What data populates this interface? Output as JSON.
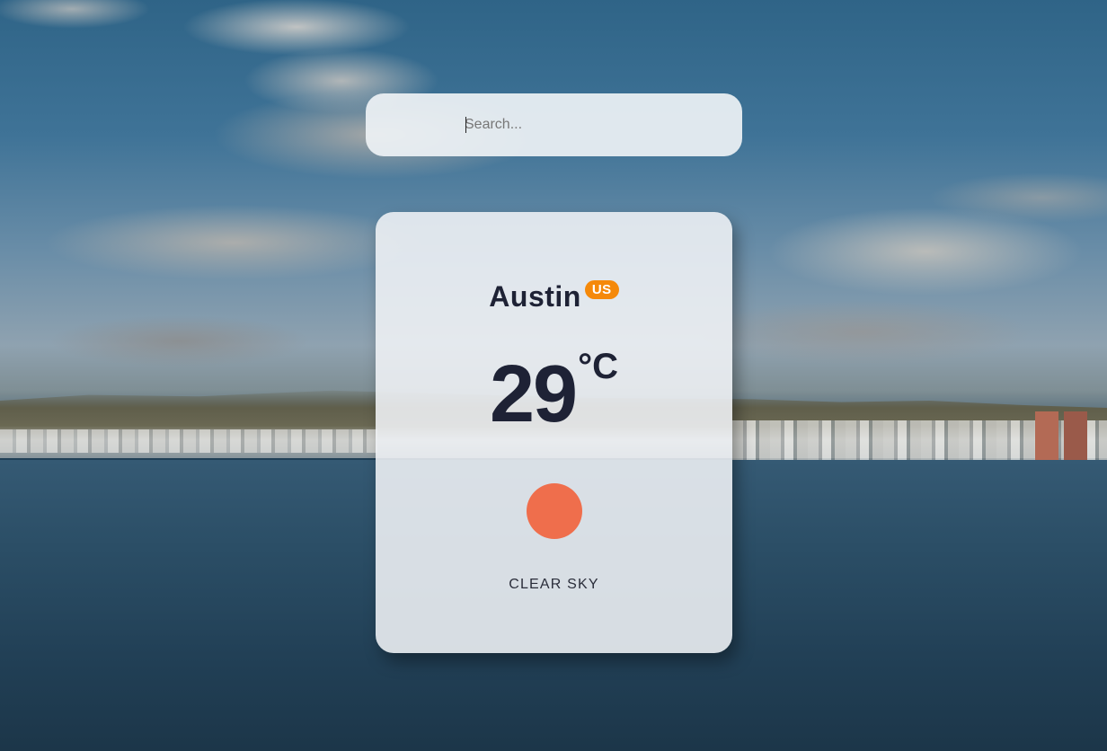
{
  "search": {
    "placeholder": "Search...",
    "value": ""
  },
  "weather": {
    "city": "Austin",
    "country": "US",
    "temperature": "29",
    "unit": "°C",
    "description": "CLEAR SKY",
    "icon": "sun-icon"
  },
  "colors": {
    "badge": "#f5890a",
    "sun": "#ef6e4c",
    "text": "#1e2235"
  }
}
